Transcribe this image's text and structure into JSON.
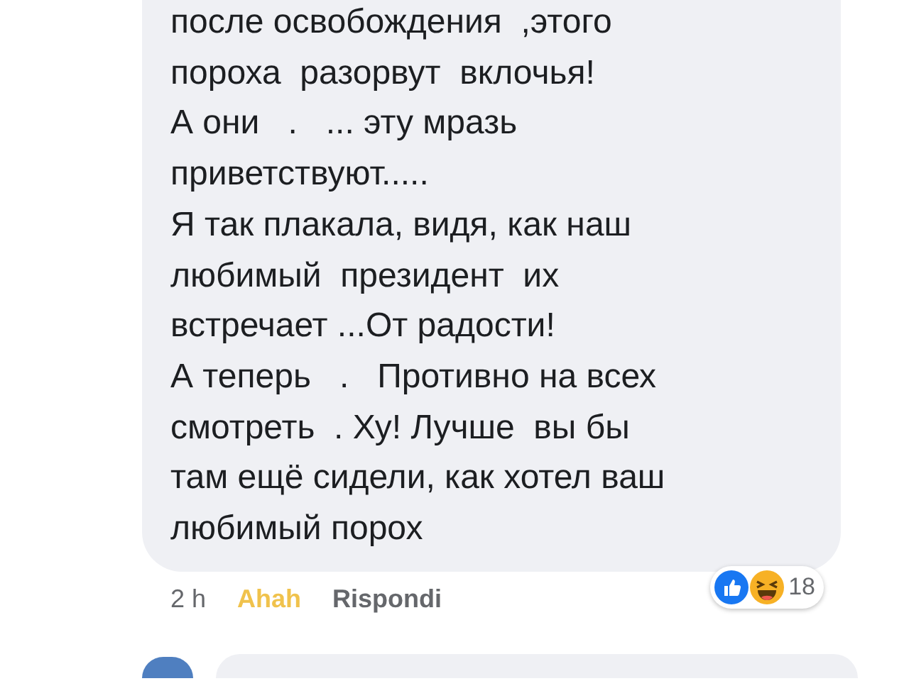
{
  "comment": {
    "text": "после освобождения  ,этого\nпороха  разорвут  вклочья!\nА они   .   ... эту мразь\nприветствуют.....\nЯ так плакала, видя, как наш\nлюбимый  президент  их\nвстречает ...От радости!\nА теперь   .   Противно на всех\nсмотреть  . Ху! Лучше  вы бы\nтам ещё сидели, как хотел ваш\nлюбимый порох",
    "time": "2 h",
    "reaction_label": "Ahah",
    "reply_label": "Rispondi",
    "reaction_count": "18"
  }
}
